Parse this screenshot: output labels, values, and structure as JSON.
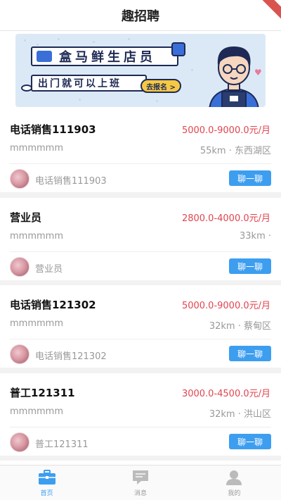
{
  "header": {
    "title": "趣招聘"
  },
  "banner": {
    "title": "盒马鲜生店员",
    "subtitle": "出门就可以上班",
    "cta": "去报名 >"
  },
  "jobs": [
    {
      "title": "电话销售111903",
      "salary": "5000.0-9000.0元/月",
      "desc": "mmmmmm",
      "location": "55km · 东西湖区",
      "company": "电话销售111903",
      "chat_label": "聊一聊"
    },
    {
      "title": "营业员",
      "salary": "2800.0-4000.0元/月",
      "desc": "mmmmmm",
      "location": "33km ·",
      "company": "营业员",
      "chat_label": "聊一聊"
    },
    {
      "title": "电话销售121302",
      "salary": "5000.0-9000.0元/月",
      "desc": "mmmmmm",
      "location": "32km · 蔡甸区",
      "company": "电话销售121302",
      "chat_label": "聊一聊"
    },
    {
      "title": "普工121311",
      "salary": "3000.0-4500.0元/月",
      "desc": "mmmmmm",
      "location": "32km · 洪山区",
      "company": "普工121311",
      "chat_label": "聊一聊"
    }
  ],
  "tabs": [
    {
      "label": "首页",
      "icon": "briefcase-icon",
      "active": true
    },
    {
      "label": "消息",
      "icon": "message-icon",
      "active": false
    },
    {
      "label": "我的",
      "icon": "user-icon",
      "active": false
    }
  ],
  "colors": {
    "accent": "#3d9ef0",
    "salary": "#e0454f",
    "banner_bg": "#dbe9f7"
  }
}
